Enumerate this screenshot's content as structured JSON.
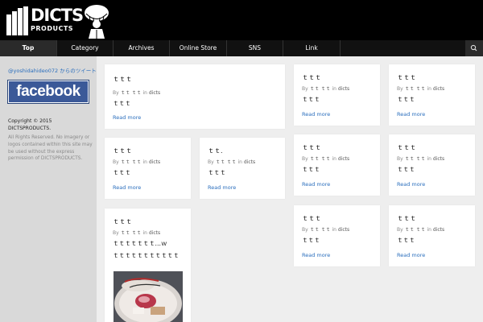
{
  "logo": {
    "word": "DICTS",
    "sub": "PRODUCTS"
  },
  "nav": {
    "items": [
      {
        "label": "Top",
        "active": true
      },
      {
        "label": "Category"
      },
      {
        "label": "Archives"
      },
      {
        "label": "Online Store"
      },
      {
        "label": "SNS"
      },
      {
        "label": "Link"
      }
    ]
  },
  "sidebar": {
    "twitter": "@yoshidahideo072 からのツイート",
    "facebook_badge": "facebook",
    "copyright": "Copyright © 2015 DICTSPRODUCTS.",
    "rights": "All Rights Reserved. No imagery or logos contained within this site may be used without the express permission of DICTSPRODUCTS."
  },
  "posts": [
    {
      "title": "ｔｔｔ",
      "by": "By",
      "author": "ｔｔ ｔｔ",
      "in": "in",
      "category": "dicts",
      "excerpt": "ｔｔｔ",
      "more": "Read more"
    },
    {
      "title": "ｔｔｔ",
      "by": "By",
      "author": "ｔｔ ｔｔ",
      "in": "in",
      "category": "dicts",
      "excerpt": "ｔｔｔ",
      "more": "Read more"
    },
    {
      "title": "ｔｔｔ",
      "by": "By",
      "author": "ｔｔ ｔｔ",
      "in": "in",
      "category": "dicts",
      "excerpt": "ｔｔｔ",
      "more": "Read more"
    },
    {
      "title": "ｔｔｔ",
      "by": "By",
      "author": "ｔｔ ｔｔ",
      "in": "in",
      "category": "dicts",
      "excerpt": "ｔｔｔ",
      "more": "Read more"
    },
    {
      "title": "ｔｔ.",
      "by": "By",
      "author": "ｔｔ ｔｔ",
      "in": "in",
      "category": "dicts",
      "excerpt": "ｔｔｔ",
      "more": "Read more"
    },
    {
      "title": "ｔｔｔ",
      "by": "By",
      "author": "ｔｔ ｔｔ",
      "in": "in",
      "category": "dicts",
      "excerpt": "ｔｔｔ",
      "more": "Read more"
    },
    {
      "title": "ｔｔｔ",
      "by": "By",
      "author": "ｔｔ ｔｔ",
      "in": "in",
      "category": "dicts",
      "excerpt": "ｔｔｔ",
      "more": "Read more"
    },
    {
      "title": "ｔｔｔ",
      "by": "By",
      "author": "ｔｔ ｔｔ",
      "in": "in",
      "category": "dicts",
      "excerpt": "ｔｔｔｔｔｔｔ…ｗ",
      "excerpt2": "ｔｔｔｔｔｔｔｔｔｔｔ"
    },
    {
      "title": "ｔｔｔ",
      "by": "By",
      "author": "ｔｔ ｔｔ",
      "in": "in",
      "category": "dicts",
      "excerpt": "ｔｔｔ",
      "more": "Read more"
    },
    {
      "title": "ｔｔｔ",
      "by": "By",
      "author": "ｔｔ ｔｔ",
      "in": "in",
      "category": "dicts",
      "excerpt": "ｔｔｔ",
      "more": "Read more"
    }
  ],
  "colors": {
    "link": "#2a6ebd",
    "facebook": "#3b5998"
  },
  "icons": {
    "search": "search-icon",
    "mascot": "mascot-icon"
  }
}
